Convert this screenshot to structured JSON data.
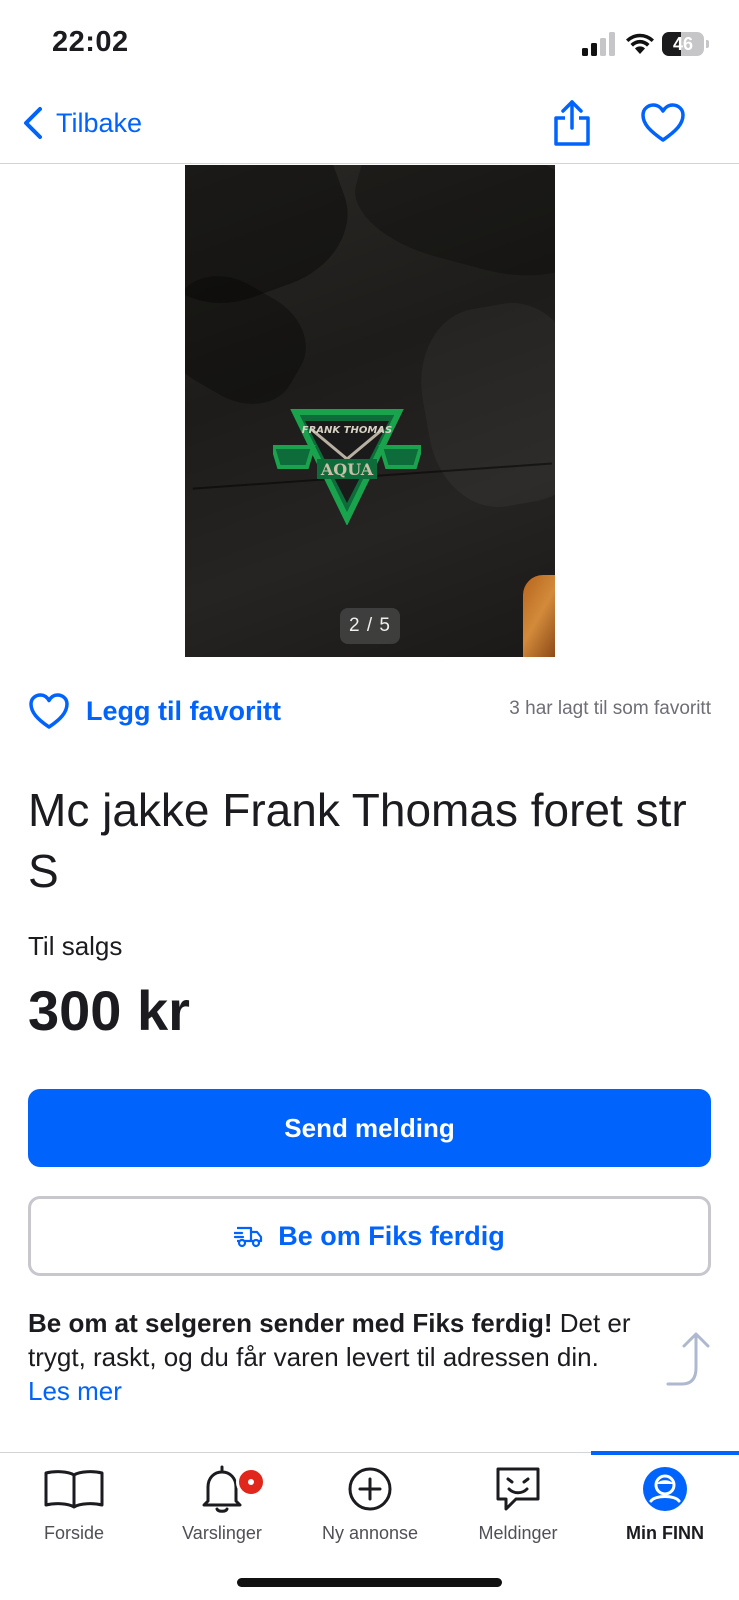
{
  "status_bar": {
    "time": "22:02",
    "battery": "46",
    "battery_level": 0.46
  },
  "nav": {
    "back_label": "Tilbake",
    "share_icon": "share-icon",
    "favorite_icon": "heart-icon"
  },
  "gallery": {
    "counter": "2 / 5",
    "patch_brand": "FRANK THOMAS",
    "patch_text": "AQUA"
  },
  "favorite": {
    "label": "Legg til favoritt",
    "count_text": "3 har lagt til som favoritt"
  },
  "listing": {
    "title": "Mc jakke Frank Thomas foret str S",
    "sale_type": "Til salgs",
    "price": "300 kr"
  },
  "actions": {
    "send_label": "Send melding",
    "fiks_label": "Be om Fiks ferdig"
  },
  "info": {
    "bold": "Be om at selgeren sender med Fiks ferdig!",
    "text": " Det er trygt, raskt, og du får varen levert til adressen din. ",
    "link": "Les mer"
  },
  "tabs": [
    {
      "label": "Forside",
      "icon": "book-icon"
    },
    {
      "label": "Varslinger",
      "icon": "bell-icon"
    },
    {
      "label": "Ny annonse",
      "icon": "plus-circle-icon"
    },
    {
      "label": "Meldinger",
      "icon": "chat-icon"
    },
    {
      "label": "Min FINN",
      "icon": "profile-icon"
    }
  ],
  "colors": {
    "accent": "#0063fb",
    "text": "#1b1b20",
    "badge": "#e1261c",
    "muted": "#6e6e76"
  }
}
